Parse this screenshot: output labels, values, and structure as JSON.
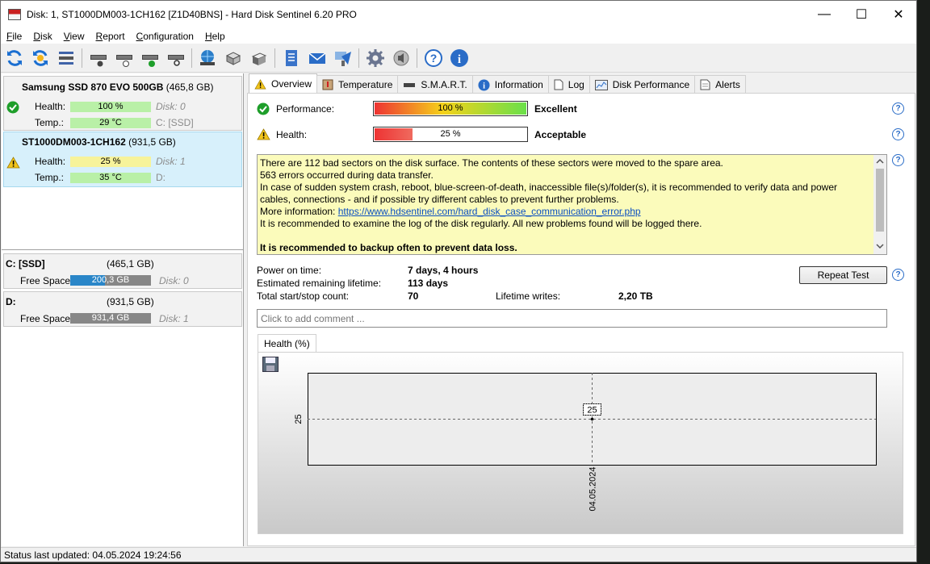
{
  "window": {
    "title": "Disk: 1, ST1000DM003-1CH162 [Z1D40BNS]  -  Hard Disk Sentinel 6.20 PRO",
    "controls": {
      "minimize": "—",
      "maximize": "☐",
      "close": "✕"
    }
  },
  "menu": {
    "file": {
      "ul": "F",
      "rest": "ile"
    },
    "disk": {
      "ul": "D",
      "rest": "isk"
    },
    "view": {
      "ul": "V",
      "rest": "iew"
    },
    "report": {
      "ul": "R",
      "rest": "eport"
    },
    "configuration": {
      "ul": "C",
      "rest": "onfiguration"
    },
    "help": {
      "ul": "H",
      "rest": "elp"
    }
  },
  "disks": [
    {
      "name": "Samsung SSD 870 EVO 500GB",
      "size": "(465,8 GB)",
      "health_label": "Health:",
      "health_value": "100 %",
      "health_pct": 100,
      "temp_label": "Temp.:",
      "temp_value": "29 °C",
      "disk_ref": "Disk: 0",
      "volume": "C: [SSD]",
      "status": "ok"
    },
    {
      "name": "ST1000DM003-1CH162",
      "size": "(931,5 GB)",
      "health_label": "Health:",
      "health_value": "25 %",
      "health_pct": 25,
      "temp_label": "Temp.:",
      "temp_value": "35 °C",
      "disk_ref": "Disk: 1",
      "volume": "D:",
      "status": "warning"
    }
  ],
  "volumes": [
    {
      "name": "C: [SSD]",
      "size": "(465,1 GB)",
      "free_label": "Free Space",
      "free_value": "200,3 GB",
      "free_fraction": 0.43,
      "disk_ref": "Disk: 0"
    },
    {
      "name": "D:",
      "size": "(931,5 GB)",
      "free_label": "Free Space",
      "free_value": "931,4 GB",
      "free_fraction": 1.0,
      "disk_ref": "Disk: 1"
    }
  ],
  "tabs": [
    {
      "label": "Overview",
      "icon": "warning-icon",
      "active": true
    },
    {
      "label": "Temperature",
      "icon": "thermometer-icon"
    },
    {
      "label": "S.M.A.R.T.",
      "icon": "smart-icon"
    },
    {
      "label": "Information",
      "icon": "info-icon"
    },
    {
      "label": "Log",
      "icon": "log-icon"
    },
    {
      "label": "Disk Performance",
      "icon": "performance-icon"
    },
    {
      "label": "Alerts",
      "icon": "alerts-icon"
    }
  ],
  "overview": {
    "performance_label": "Performance:",
    "performance_value": "100 %",
    "performance_pct": 100,
    "performance_verdict": "Excellent",
    "health_label": "Health:",
    "health_value": "25 %",
    "health_pct": 25,
    "health_verdict": "Acceptable",
    "message": {
      "line1": "There are 112 bad sectors on the disk surface. The contents of these sectors were moved to the spare area.",
      "line2": "563 errors occurred during data transfer.",
      "line3": "In case of sudden system crash, reboot, blue-screen-of-death, inaccessible file(s)/folder(s), it is recommended to verify data and power cables, connections - and if possible try different cables to prevent further problems.",
      "more_info_label": "More information: ",
      "more_info_link": "https://www.hdsentinel.com/hard_disk_case_communication_error.php",
      "line5": "It is recommended to examine the log of the disk regularly. All new problems found will be logged there.",
      "line6": "It is recommended to backup often to prevent data loss."
    },
    "power_on_label": "Power on time:",
    "power_on_value": "7 days, 4 hours",
    "lifetime_label": "Estimated remaining lifetime:",
    "lifetime_value": "113 days",
    "startstop_label": "Total start/stop count:",
    "startstop_value": "70",
    "writes_label": "Lifetime writes:",
    "writes_value": "2,20 TB",
    "repeat_button": "Repeat Test",
    "comment_placeholder": "Click to add comment ...",
    "help_glyph": "?"
  },
  "chart_data": {
    "type": "line",
    "tab_label": "Health (%)",
    "x": [
      "04.05.2024"
    ],
    "series": [
      {
        "values": [
          25
        ]
      }
    ],
    "ytick": "25",
    "point_label": "25",
    "xtick": "04.05.2024"
  },
  "statusbar": {
    "text": "Status last updated: 04.05.2024 19:24:56"
  },
  "colors": {
    "health_green": "#b9f0a7",
    "health_yellow": "#f7f39a",
    "selected_row": "#d7f0fb",
    "free_space_blue": "#2a86c8",
    "free_space_grey": "#878787",
    "message_bg": "#fbfbbb",
    "link": "#0b4fc0"
  }
}
